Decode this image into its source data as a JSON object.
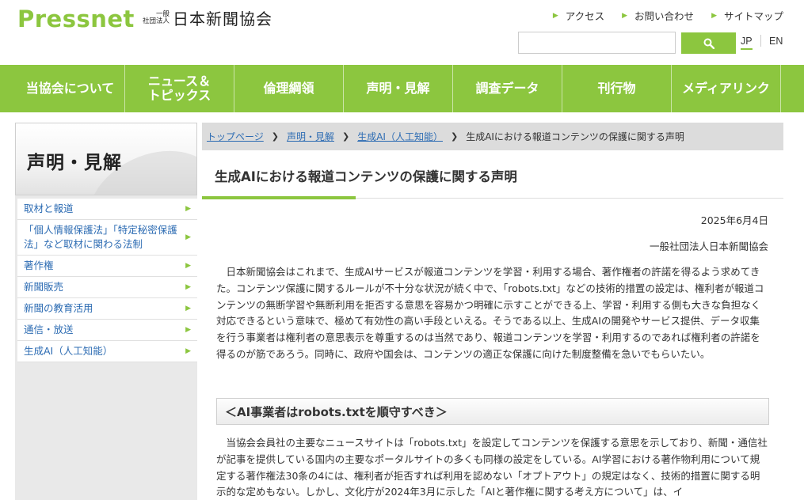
{
  "header": {
    "logo_mark": "Pressnet",
    "logo_small_line1": "一般",
    "logo_small_line2": "社団法人",
    "logo_name": "日本新聞協会",
    "util_links": [
      "アクセス",
      "お問い合わせ",
      "サイトマップ"
    ],
    "search": {
      "value": "",
      "placeholder": ""
    },
    "lang_jp": "JP",
    "lang_en": "EN"
  },
  "nav": {
    "items": [
      "当協会について",
      "ニュース＆\nトピックス",
      "倫理綱領",
      "声明・見解",
      "調査データ",
      "刊行物",
      "メディアリンク"
    ]
  },
  "sidebar": {
    "title": "声明・見解",
    "items": [
      "取材と報道",
      "「個人情報保護法」「特定秘密保護法」など取材に関わる法制",
      "著作権",
      "新聞販売",
      "新聞の教育活用",
      "通信・放送",
      "生成AI（人工知能）"
    ]
  },
  "breadcrumb": {
    "items": [
      "トップページ",
      "声明・見解",
      "生成AI（人工知能）"
    ],
    "current": "生成AIにおける報道コンテンツの保護に関する声明"
  },
  "article": {
    "title": "生成AIにおける報道コンテンツの保護に関する声明",
    "date": "2025年6月4日",
    "org": "一般社団法人日本新聞協会",
    "para1": "日本新聞協会はこれまで、生成AIサービスが報道コンテンツを学習・利用する場合、著作権者の許諾を得るよう求めてきた。コンテンツ保護に関するルールが不十分な状況が続く中で、「robots.txt」などの技術的措置の設定は、権利者が報道コンテンツの無断学習や無断利用を拒否する意思を容易かつ明確に示すことができる上、学習・利用する側も大きな負担なく対応できるという意味で、極めて有効性の高い手段といえる。そうである以上、生成AIの開発やサービス提供、データ収集を行う事業者は権利者の意思表示を尊重するのは当然であり、報道コンテンツを学習・利用するのであれば権利者の許諾を得るのが筋であろう。同時に、政府や国会は、コンテンツの適正な保護に向けた制度整備を急いでもらいたい。",
    "subhead": "＜AI事業者はrobots.txtを順守すべき＞",
    "para2": "当協会会員社の主要なニュースサイトは「robots.txt」を設定してコンテンツを保護する意思を示しており、新聞・通信社が記事を提供している国内の主要なポータルサイトの多くも同様の設定をしている。AI学習における著作物利用について規定する著作権法30条の4には、権利者が拒否すれば利用を認めない「オプトアウト」の規定はなく、技術的措置に関する明示的な定めもない。しかし、文化庁が2024年3月に示した「AIと著作権に関する考え方について」は、イ"
  }
}
